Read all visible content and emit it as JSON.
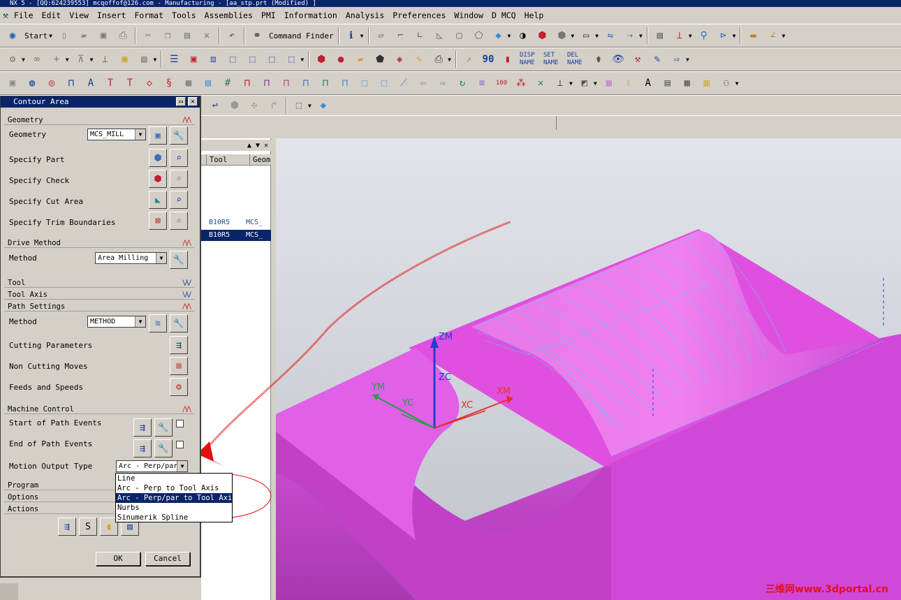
{
  "title": "NX 5 - [QQ:624239553] mcqoffof@126.com - Manufacturing - [aa_stp.prt (Modified) ]",
  "menu": [
    "File",
    "Edit",
    "View",
    "Insert",
    "Format",
    "Tools",
    "Assemblies",
    "PMI",
    "Information",
    "Analysis",
    "Preferences",
    "Window",
    "D MCQ",
    "Help"
  ],
  "toolbar1": {
    "start_label": "Start",
    "command_finder_label": "Command Finder"
  },
  "toolbar2": {
    "disp_name": "DISP NAME",
    "set_name": "SET NAME",
    "del_name": "DEL NAME"
  },
  "navigator": {
    "columns": [
      "Tool",
      "Geom"
    ],
    "rows": [
      {
        "tool": "B10R5",
        "geom": "MCS_",
        "selected": false
      },
      {
        "tool": "B10R5",
        "geom": "MCS_",
        "selected": true
      }
    ]
  },
  "dialog": {
    "title": "Contour Area",
    "geometry": {
      "section": "Geometry",
      "geometry_label": "Geometry",
      "geometry_value": "MCS_MILL",
      "specify_part": "Specify Part",
      "specify_check": "Specify Check",
      "specify_cut_area": "Specify Cut Area",
      "specify_trim": "Specify Trim Boundaries"
    },
    "drive": {
      "section": "Drive Method",
      "method_label": "Method",
      "method_value": "Area Milling"
    },
    "tool_section": "Tool",
    "tool_axis_section": "Tool Axis",
    "path": {
      "section": "Path Settings",
      "method_label": "Method",
      "method_value": "METHOD",
      "cutting": "Cutting Parameters",
      "non_cutting": "Non Cutting Moves",
      "feeds": "Feeds and Speeds"
    },
    "machine": {
      "section": "Machine Control",
      "start_events": "Start of Path Events",
      "end_events": "End of Path Events",
      "motion_label": "Motion Output Type",
      "motion_value": "Arc - Perp/par"
    },
    "program_section": "Program",
    "options_section": "Options",
    "actions_section": "Actions",
    "ok": "OK",
    "cancel": "Cancel"
  },
  "motion_options": [
    "Line",
    "Arc - Perp to Tool Axis",
    "Arc - Perp/par to Tool Axis",
    "Nurbs",
    "Sinumerik Spline"
  ],
  "motion_selected_index": 2,
  "axes": {
    "zm": "ZM",
    "zc": "ZC",
    "ym": "YM",
    "yc": "YC",
    "xc": "XC",
    "xm": "XM"
  },
  "watermark": "三维网www.3dportal.cn",
  "colors": {
    "part": "#e040e0",
    "part_shade": "#b030b8",
    "part_dark": "#9a2aa0",
    "toolpath": "#4ad6f0",
    "annotation": "#e01010",
    "titlebar": "#0a246a"
  }
}
